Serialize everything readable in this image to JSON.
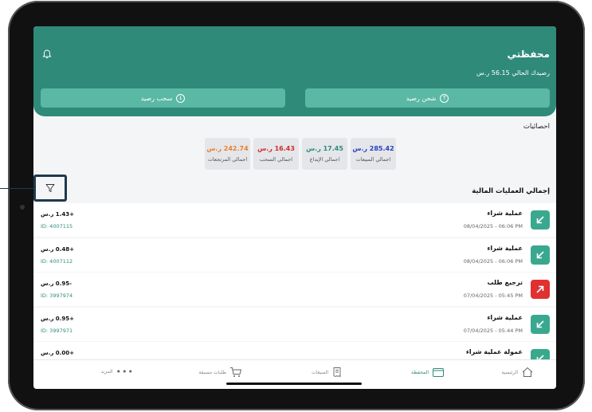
{
  "header": {
    "title": "محفظتي",
    "balance": "رصيدك الحالي 56.15 ر.س",
    "withdraw_label": "سحب رصيد",
    "topup_label": "شحن رصيد"
  },
  "stats": {
    "title": "احصائيات",
    "items": [
      {
        "value": "242.74 ر.س",
        "label": "اجمالي المرتجعات",
        "color": "#e8812a"
      },
      {
        "value": "16.43 ر.س",
        "label": "اجمالي السحب",
        "color": "#d42a2a"
      },
      {
        "value": "17.45 ر.س",
        "label": "اجمالي الإيداع",
        "color": "#2f8a7a"
      },
      {
        "value": "285.42 ر.س",
        "label": "اجمالي المبيعات",
        "color": "#2a3fc4"
      }
    ]
  },
  "operations": {
    "title": "إجمالي العمليات المالية",
    "rows": [
      {
        "title": "عملية شراء",
        "date": "08/04/2025 - 06:06 PM",
        "amount": "+1.43 ر.س",
        "id": "ID: 4007115",
        "type": "in"
      },
      {
        "title": "عملية شراء",
        "date": "08/04/2025 - 06:06 PM",
        "amount": "+0.48 ر.س",
        "id": "ID: 4007112",
        "type": "in"
      },
      {
        "title": "ترجيع طلب",
        "date": "07/04/2025 - 05:45 PM",
        "amount": "-0.95 ر.س",
        "id": "ID: 3997974",
        "type": "out"
      },
      {
        "title": "عملية شراء",
        "date": "07/04/2025 - 05:44 PM",
        "amount": "+0.95 ر.س",
        "id": "ID: 3997971",
        "type": "in"
      },
      {
        "title": "عمولة عملية شراء",
        "date": "",
        "amount": "+0.00 ر.س",
        "id": "",
        "type": "in"
      }
    ]
  },
  "nav": {
    "home": "الرئيسية",
    "wallet": "المحفظة",
    "sales": "المبيعات",
    "preorders": "طلبات مسبقة",
    "more": "المزيد"
  },
  "colors": {
    "accent": "#2f8a7a",
    "in_badge": "#3aa88f",
    "out_badge": "#e03030"
  }
}
